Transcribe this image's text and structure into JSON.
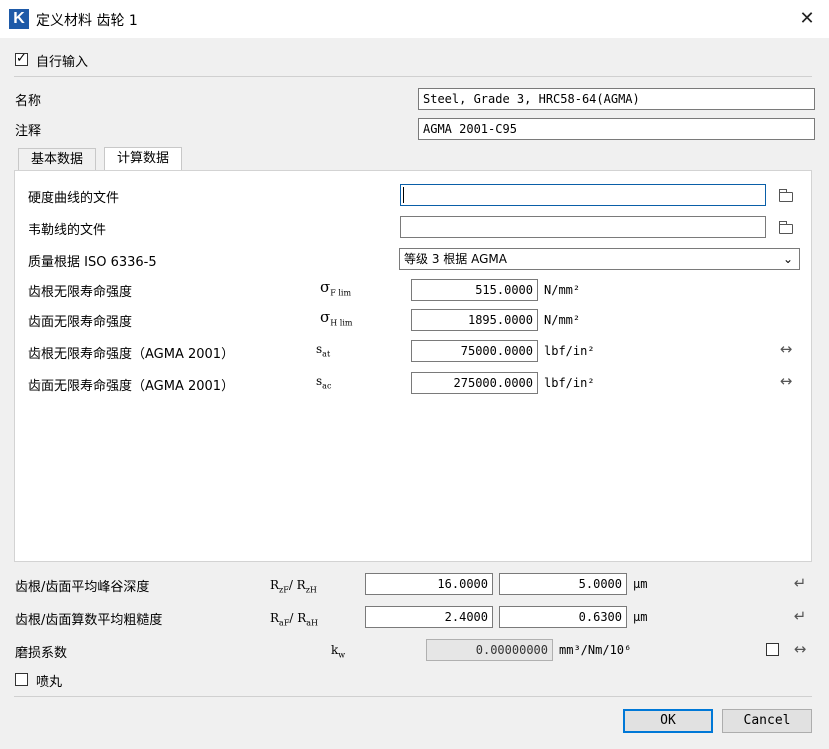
{
  "window": {
    "title": "定义材料 齿轮 1",
    "app_icon_letter": "K"
  },
  "self_input": {
    "label": "自行输入",
    "checked": true
  },
  "name": {
    "label": "名称",
    "value": "Steel, Grade 3, HRC58-64(AGMA)"
  },
  "comment": {
    "label": "注释",
    "value": "AGMA 2001-C95"
  },
  "tabs": [
    {
      "label": "基本数据",
      "active": false
    },
    {
      "label": "计算数据",
      "active": true
    }
  ],
  "calc": {
    "hardness_file": {
      "label": "硬度曲线的文件",
      "value": ""
    },
    "woehler_file": {
      "label": "韦勒线的文件",
      "value": ""
    },
    "quality": {
      "label": "质量根据 ISO 6336-5",
      "selected": "等级 3 根据 AGMA"
    },
    "rows": [
      {
        "label": "齿根无限寿命强度",
        "sym": "σ",
        "sub": "F lim",
        "value": "515.0000",
        "unit": "N/mm²",
        "has_arrow": false
      },
      {
        "label": "齿面无限寿命强度",
        "sym": "σ",
        "sub": "H lim",
        "value": "1895.0000",
        "unit": "N/mm²",
        "has_arrow": false
      },
      {
        "label": "齿根无限寿命强度（AGMA 2001）",
        "sym": "s",
        "sub": "at",
        "value": "75000.0000",
        "unit": "lbf/in²",
        "has_arrow": true
      },
      {
        "label": "齿面无限寿命强度（AGMA 2001）",
        "sym": "s",
        "sub": "ac",
        "value": "275000.0000",
        "unit": "lbf/in²",
        "has_arrow": true
      }
    ]
  },
  "roughness": [
    {
      "label": "齿根/齿面平均峰谷深度",
      "sym1": "R",
      "sub1": "zF",
      "sym2": "R",
      "sub2": "zH",
      "v1": "16.0000",
      "v2": "5.0000",
      "unit": "μm"
    },
    {
      "label": "齿根/齿面算数平均粗糙度",
      "sym1": "R",
      "sub1": "aF",
      "sym2": "R",
      "sub2": "aH",
      "v1": "2.4000",
      "v2": "0.6300",
      "unit": "μm"
    }
  ],
  "wear": {
    "label": "磨损系数",
    "sym": "k",
    "sub": "w",
    "value": "0.00000000",
    "unit": "mm³/Nm/10⁶",
    "checked": false
  },
  "shot_peening": {
    "label": "喷丸",
    "checked": false
  },
  "buttons": {
    "ok": "OK",
    "cancel": "Cancel"
  },
  "icons": {
    "double_arrow": "↔",
    "return": "↵",
    "close": "✕"
  }
}
